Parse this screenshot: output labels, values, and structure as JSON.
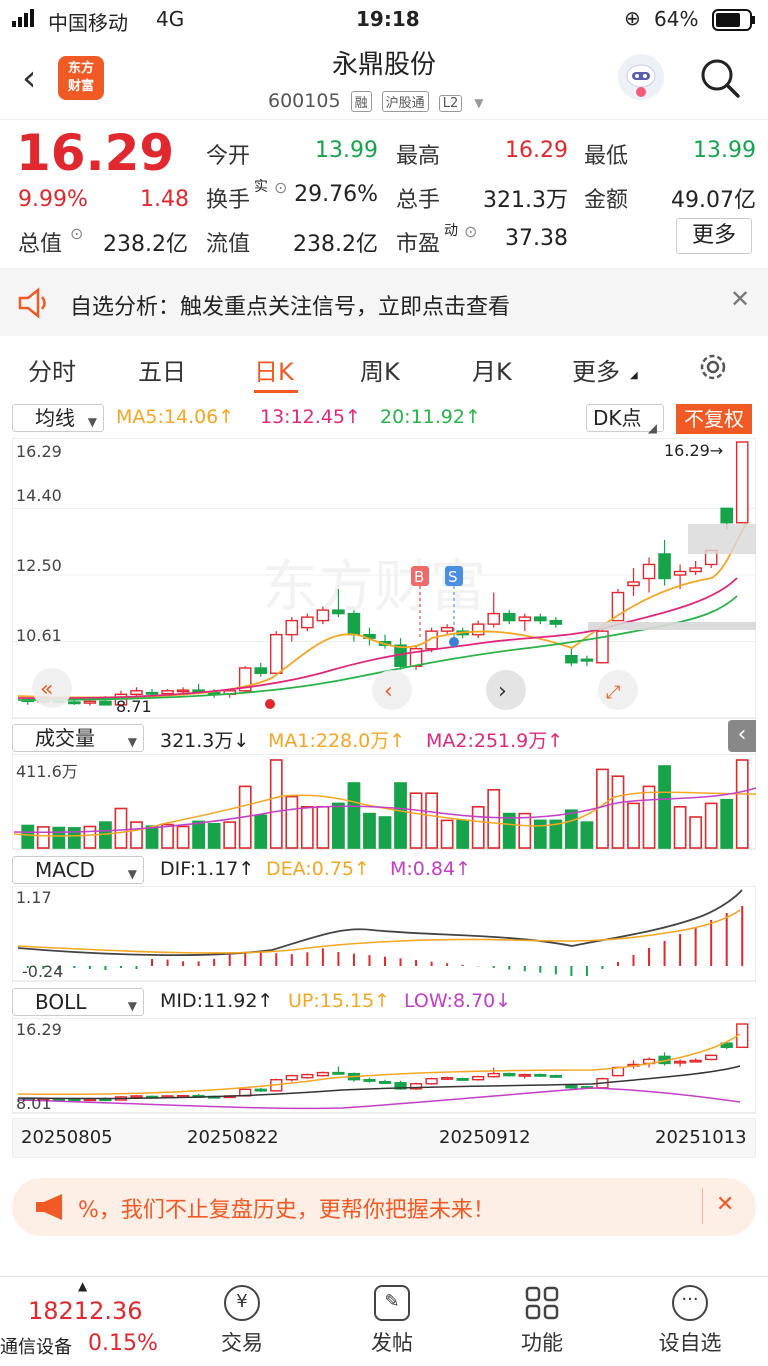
{
  "status_bar": {
    "carrier": "中国移动",
    "network": "4G",
    "time": "19:18",
    "battery": "64%"
  },
  "header": {
    "title": "永鼎股份",
    "code": "600105",
    "tags": [
      "融",
      "沪股通",
      "L2"
    ],
    "logo_text": "东方财富"
  },
  "quote": {
    "price": "16.29",
    "change_pct": "9.99%",
    "change": "1.48",
    "open_label": "今开",
    "open": "13.99",
    "high_label": "最高",
    "high": "16.29",
    "low_label": "最低",
    "low": "13.99",
    "turnover_label": "换手",
    "turnover_sup": "实",
    "turnover": "29.76%",
    "volume_label": "总手",
    "volume": "321.3万",
    "amount_label": "金额",
    "amount": "49.07亿",
    "mktcap_label": "总值",
    "mktcap": "238.2亿",
    "float_label": "流值",
    "float": "238.2亿",
    "pe_label": "市盈",
    "pe_sup": "动",
    "pe": "37.38",
    "more_label": "更多"
  },
  "notice": {
    "text": "自选分析：触发重点关注信号，立即点击查看"
  },
  "tabs": [
    "分时",
    "五日",
    "日K",
    "周K",
    "月K",
    "更多"
  ],
  "active_tab": "日K",
  "kline": {
    "selector": "均线",
    "ma5": "MA5:14.06↑",
    "ma13": "13:12.45↑",
    "ma20": "20:11.92↑",
    "dk_label": "DK点",
    "fq_label": "不复权",
    "y_ticks": [
      "16.29",
      "14.40",
      "12.50",
      "10.61",
      "8.71"
    ],
    "price_marker": "16.29→",
    "low_marker": "8.71",
    "signal_b": "B",
    "signal_s": "S",
    "watermark": "东方财富"
  },
  "volume": {
    "selector": "成交量",
    "current": "321.3万↓",
    "ma1": "MA1:228.0万↑",
    "ma2": "MA2:251.9万↑",
    "y_top": "411.6万"
  },
  "macd": {
    "selector": "MACD",
    "dif": "DIF:1.17↑",
    "dea": "DEA:0.75↑",
    "m": "M:0.84↑",
    "y_top": "1.17",
    "y_bottom": "-0.24"
  },
  "boll": {
    "selector": "BOLL",
    "mid": "MID:11.92↑",
    "up": "UP:15.15↑",
    "low": "LOW:8.70↓",
    "y_top": "16.29",
    "y_bottom": "8.01"
  },
  "dates": [
    "20250805",
    "20250822",
    "20250912",
    "20251013"
  ],
  "banner": {
    "text": "%，我们不止复盘历史，更帮你把握未来！"
  },
  "bottom": {
    "index_value": "18212.36",
    "index_name": "通信设备",
    "index_pct": "0.15%",
    "items": [
      "交易",
      "发帖",
      "功能",
      "设自选"
    ]
  },
  "colors": {
    "up": "#e0282e",
    "down": "#16a34a",
    "brand": "#f15a24",
    "ma5": "#f5a623",
    "ma13": "#e0287a",
    "ma20": "#2bb34a"
  },
  "chart_data": {
    "type": "candlestick",
    "ylim": [
      8.71,
      16.29
    ],
    "ohlc": [
      [
        8.95,
        9.0,
        8.8,
        8.9
      ],
      [
        8.9,
        9.0,
        8.82,
        8.93
      ],
      [
        8.92,
        9.0,
        8.85,
        8.88
      ],
      [
        8.88,
        8.95,
        8.8,
        8.85
      ],
      [
        8.85,
        8.95,
        8.78,
        8.9
      ],
      [
        8.9,
        9.05,
        8.8,
        8.8
      ],
      [
        8.8,
        9.2,
        8.75,
        9.1
      ],
      [
        9.1,
        9.3,
        9.05,
        9.2
      ],
      [
        9.15,
        9.25,
        9.05,
        9.12
      ],
      [
        9.12,
        9.25,
        9.05,
        9.2
      ],
      [
        9.2,
        9.3,
        9.1,
        9.22
      ],
      [
        9.22,
        9.4,
        9.1,
        9.15
      ],
      [
        9.15,
        9.25,
        9.0,
        9.1
      ],
      [
        9.1,
        9.25,
        9.0,
        9.2
      ],
      [
        9.2,
        9.9,
        9.15,
        9.85
      ],
      [
        9.85,
        10.0,
        9.6,
        9.7
      ],
      [
        9.7,
        10.9,
        9.7,
        10.8
      ],
      [
        10.8,
        11.3,
        10.6,
        11.2
      ],
      [
        11.0,
        11.4,
        10.9,
        11.3
      ],
      [
        11.2,
        11.6,
        11.1,
        11.5
      ],
      [
        11.5,
        12.1,
        11.3,
        11.4
      ],
      [
        11.4,
        11.5,
        10.6,
        10.8
      ],
      [
        10.8,
        11.0,
        10.5,
        10.7
      ],
      [
        10.6,
        10.8,
        10.4,
        10.5
      ],
      [
        10.5,
        10.7,
        9.8,
        9.9
      ],
      [
        9.9,
        10.5,
        9.8,
        10.4
      ],
      [
        10.4,
        11.0,
        10.3,
        10.9
      ],
      [
        10.9,
        11.1,
        10.8,
        11.0
      ],
      [
        10.9,
        11.0,
        10.7,
        10.8
      ],
      [
        10.8,
        11.2,
        10.7,
        11.1
      ],
      [
        11.1,
        12.0,
        11.0,
        11.4
      ],
      [
        11.4,
        11.5,
        11.1,
        11.2
      ],
      [
        11.2,
        11.4,
        10.9,
        11.3
      ],
      [
        11.3,
        11.4,
        11.1,
        11.2
      ],
      [
        11.2,
        11.3,
        11.0,
        11.1
      ],
      [
        10.2,
        10.4,
        9.9,
        10.0
      ],
      [
        10.1,
        10.2,
        9.9,
        10.05
      ],
      [
        10.0,
        11.0,
        10.0,
        10.9
      ],
      [
        11.2,
        12.1,
        11.2,
        12.0
      ],
      [
        12.2,
        12.7,
        11.9,
        12.3
      ],
      [
        12.4,
        13.0,
        12.0,
        12.8
      ],
      [
        13.1,
        13.5,
        12.2,
        12.4
      ],
      [
        12.5,
        12.8,
        12.1,
        12.6
      ],
      [
        12.6,
        12.9,
        12.5,
        12.7
      ],
      [
        12.8,
        13.2,
        12.7,
        13.2
      ],
      [
        14.4,
        14.4,
        13.8,
        13.99
      ],
      [
        13.99,
        16.29,
        13.99,
        16.29
      ]
    ]
  }
}
